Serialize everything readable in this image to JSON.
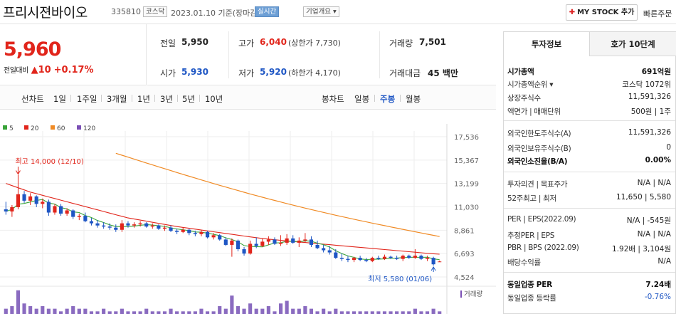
{
  "header": {
    "stock_name": "프리시젼바이오",
    "stock_code": "335810",
    "market": "코스닥",
    "date": "2023.01.10 기준(장마감)",
    "realtime": "실시간",
    "company_info": "기업개요 ▾",
    "mystock": "MY STOCK 추가",
    "quick_order": "빠른주문"
  },
  "price": {
    "current": "5,960",
    "change_label": "전일대비",
    "change_value": "▲10",
    "change_rate": "+0.17%"
  },
  "info": {
    "prev_close_label": "전일",
    "prev_close": "5,950",
    "high_label": "고가",
    "high": "6,040",
    "high_sub": "(상한가 7,730)",
    "volume_label": "거래량",
    "volume": "7,501",
    "open_label": "시가",
    "open": "5,930",
    "low_label": "저가",
    "low": "5,920",
    "low_sub": "(하한가 4,170)",
    "amount_label": "거래대금",
    "amount": "45 백만"
  },
  "tabs": {
    "line_label": "선차트",
    "line_items": [
      "1일",
      "1주일",
      "3개월",
      "1년",
      "3년",
      "5년",
      "10년"
    ],
    "candle_label": "봉차트",
    "candle_items": [
      "일봉",
      "주봉",
      "월봉"
    ],
    "active_candle": "주봉"
  },
  "chart_data": {
    "type": "candlestick",
    "legend": [
      {
        "name": "5",
        "color": "#3aa43a"
      },
      {
        "name": "20",
        "color": "#e1251b"
      },
      {
        "name": "60",
        "color": "#f08a24"
      },
      {
        "name": "120",
        "color": "#7b4fb5"
      }
    ],
    "y_ticks": [
      4524,
      6693,
      8861,
      11030,
      13199,
      15367,
      17536
    ],
    "y_tick_labels": [
      "4,524",
      "6,693",
      "8,861",
      "11,030",
      "13,199",
      "15,367",
      "17,536"
    ],
    "ylim": [
      4524,
      17536
    ],
    "max_annotation": "최고 14,000 (12/10)",
    "min_annotation": "최저 5,580 (01/06)",
    "volume_label": "거래량",
    "candles": [
      [
        10800,
        11500,
        10300,
        10600
      ],
      [
        10600,
        11200,
        10100,
        11000
      ],
      [
        11000,
        14000,
        10800,
        12200
      ],
      [
        12200,
        12500,
        11400,
        11600
      ],
      [
        11600,
        12300,
        11200,
        12000
      ],
      [
        12000,
        12100,
        11000,
        11300
      ],
      [
        11300,
        11800,
        10900,
        11500
      ],
      [
        11500,
        11700,
        10200,
        10500
      ],
      [
        10500,
        11300,
        10300,
        11100
      ],
      [
        11100,
        11300,
        10200,
        10400
      ],
      [
        10400,
        10900,
        10200,
        10700
      ],
      [
        10700,
        10800,
        9900,
        10100
      ],
      [
        10100,
        10400,
        9800,
        10200
      ],
      [
        10200,
        10500,
        9600,
        9700
      ],
      [
        9700,
        10000,
        9300,
        9500
      ],
      [
        9500,
        9800,
        9100,
        9300
      ],
      [
        9300,
        9600,
        9000,
        9200
      ],
      [
        9200,
        9500,
        8900,
        9100
      ],
      [
        9100,
        9400,
        8700,
        8900
      ],
      [
        8900,
        9800,
        8700,
        9500
      ],
      [
        9500,
        9700,
        9100,
        9300
      ],
      [
        9300,
        9600,
        9100,
        9400
      ],
      [
        9400,
        9700,
        9200,
        9500
      ],
      [
        9500,
        9600,
        9100,
        9200
      ],
      [
        9200,
        9500,
        9000,
        9300
      ],
      [
        9300,
        9400,
        8900,
        9000
      ],
      [
        9000,
        9300,
        8800,
        9100
      ],
      [
        9100,
        9300,
        8700,
        8800
      ],
      [
        8800,
        9000,
        8500,
        8700
      ],
      [
        8700,
        9100,
        8600,
        8900
      ],
      [
        8900,
        9000,
        8400,
        8600
      ],
      [
        8600,
        8800,
        8300,
        8500
      ],
      [
        8500,
        8900,
        8300,
        8700
      ],
      [
        8700,
        8800,
        8100,
        8200
      ],
      [
        8200,
        8600,
        8000,
        8400
      ],
      [
        8400,
        8500,
        7900,
        8000
      ],
      [
        8000,
        8200,
        7400,
        7500
      ],
      [
        7500,
        8100,
        6400,
        7900
      ],
      [
        7900,
        8000,
        6900,
        7100
      ],
      [
        7100,
        7300,
        6500,
        6700
      ],
      [
        6700,
        7900,
        6600,
        7600
      ],
      [
        7600,
        8200,
        7200,
        7400
      ],
      [
        7400,
        8100,
        7300,
        7800
      ],
      [
        7800,
        8300,
        7500,
        8000
      ],
      [
        8000,
        8200,
        7500,
        7600
      ],
      [
        7600,
        8400,
        7400,
        7700
      ],
      [
        7700,
        8500,
        7500,
        8100
      ],
      [
        8100,
        8400,
        7600,
        7700
      ],
      [
        7700,
        8200,
        7300,
        7900
      ],
      [
        7900,
        8600,
        7700,
        8000
      ],
      [
        8000,
        8300,
        7300,
        7500
      ],
      [
        7500,
        7900,
        7100,
        7200
      ],
      [
        7200,
        7500,
        6800,
        7000
      ],
      [
        7000,
        7400,
        6600,
        6800
      ],
      [
        6800,
        7100,
        6200,
        6300
      ],
      [
        6300,
        6700,
        6000,
        6200
      ],
      [
        6200,
        6500,
        5900,
        6100
      ],
      [
        6100,
        6400,
        5900,
        6300
      ],
      [
        6300,
        6500,
        6000,
        6100
      ],
      [
        6100,
        6300,
        5900,
        6000
      ],
      [
        6000,
        6400,
        5900,
        6300
      ],
      [
        6300,
        6500,
        6100,
        6200
      ],
      [
        6200,
        6600,
        6100,
        6400
      ],
      [
        6400,
        6500,
        6200,
        6300
      ],
      [
        6300,
        6500,
        6100,
        6200
      ],
      [
        6200,
        6600,
        6000,
        6500
      ],
      [
        6500,
        6600,
        6200,
        6300
      ],
      [
        6300,
        7100,
        6200,
        6500
      ],
      [
        6500,
        6600,
        6100,
        6200
      ],
      [
        6200,
        6500,
        6000,
        6300
      ],
      [
        6300,
        6400,
        5580,
        5700
      ],
      [
        5930,
        6040,
        5920,
        5960
      ]
    ],
    "ma20": [
      13200,
      13000,
      12800,
      12600,
      12400,
      12250,
      12100,
      11950,
      11800,
      11650,
      11500,
      11350,
      11200,
      11050,
      10900,
      10750,
      10600,
      10450,
      10300,
      10150,
      10000,
      9900,
      9800,
      9700,
      9600,
      9500,
      9400,
      9300,
      9200,
      9120,
      9040,
      8960,
      8880,
      8800,
      8720,
      8640,
      8560,
      8480,
      8400,
      8320,
      8240,
      8170,
      8100,
      8040,
      7980,
      7920,
      7870,
      7820,
      7770,
      7720,
      7670,
      7620,
      7570,
      7520,
      7470,
      7420,
      7370,
      7320,
      7270,
      7220,
      7170,
      7120,
      7070,
      7020,
      6970,
      6920,
      6870,
      6820,
      6770,
      6720,
      6680,
      6640
    ]
  },
  "right_panel": {
    "tab_invest": "투자정보",
    "tab_hoga": "호가 10단계",
    "rows": [
      {
        "label": "시가총액",
        "value": "691억원",
        "bold": true
      },
      {
        "label": "시가총액순위 ▾",
        "value": "코스닥 1072위"
      },
      {
        "label": "상장주식수",
        "value": "11,591,326"
      },
      {
        "label": "액면가 | 매매단위",
        "value": "500원 | 1주"
      },
      {
        "label": "외국인한도주식수(A)",
        "value": "11,591,326"
      },
      {
        "label": "외국인보유주식수(B)",
        "value": "0"
      },
      {
        "label": "외국인소진율(B/A)",
        "value": "0.00%",
        "bold": true
      },
      {
        "label": "투자의견 | 목표주가",
        "value": "N/A | N/A"
      },
      {
        "label": "52주최고 | 최저",
        "value": "11,650 | 5,580"
      },
      {
        "label": "PER | EPS(2022.09)",
        "value": "N/A | -545원"
      },
      {
        "label": "추정PER | EPS",
        "value": "N/A | N/A"
      },
      {
        "label": "PBR | BPS (2022.09)",
        "value": "1.92배 | 3,104원"
      },
      {
        "label": "배당수익률",
        "value": "N/A"
      },
      {
        "label": "동일업종 PER",
        "value": "7.24배",
        "bold": true
      },
      {
        "label": "동일업종 등락률",
        "value": "-0.76%"
      }
    ]
  }
}
